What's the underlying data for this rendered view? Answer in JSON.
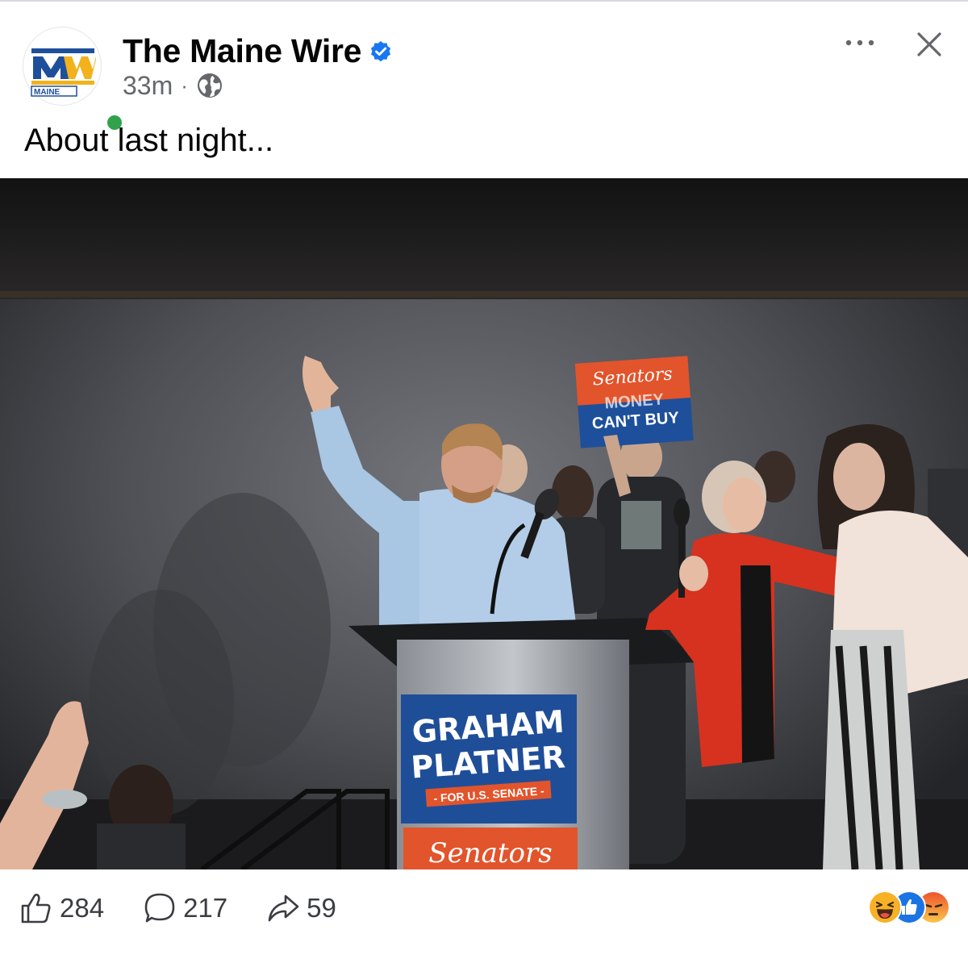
{
  "post": {
    "page_name": "The Maine Wire",
    "timestamp": "33m",
    "separator": "·",
    "privacy_icon": "globe-icon",
    "caption": "About last night...",
    "verified_badge": "verified-icon",
    "options_icon": "more-icon",
    "close_icon": "close-icon"
  },
  "avatar": {
    "logo_letters": "MW",
    "logo_text": "MAINE",
    "online_status_color": "#31a24c"
  },
  "photo": {
    "podium_sign": {
      "line1": "GRAHAM",
      "line2": "PLATNER",
      "line3": "- FOR U.S. SENATE -"
    },
    "back_sign": {
      "line1": "Senators",
      "line2": "MONEY",
      "line3": "CAN'T BUY"
    },
    "lower_sign": "Senators"
  },
  "engagement": {
    "likes": "284",
    "comments": "217",
    "shares": "59",
    "reactions": [
      "haha-icon",
      "like-icon",
      "angry-icon"
    ]
  },
  "colors": {
    "text_primary": "#050505",
    "text_secondary": "#65676b",
    "verified_blue": "#1877f2",
    "brand_blue": "#1e4f9b",
    "brand_orange": "#e2542b"
  }
}
